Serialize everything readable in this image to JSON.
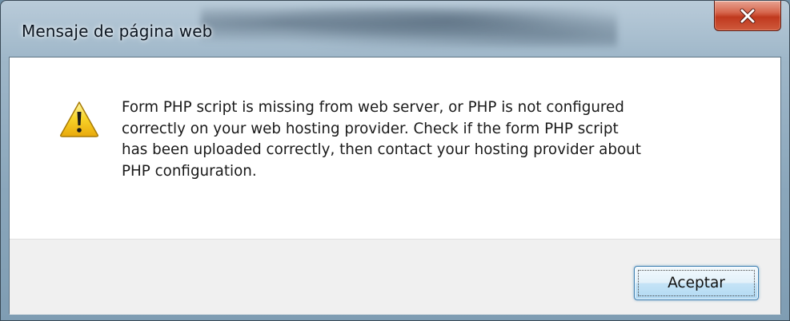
{
  "dialog": {
    "title": "Mensaje de página web",
    "message": "Form PHP script is missing from web server, or PHP is not configured\ncorrectly on your web hosting provider. Check if the form PHP script\nhas been uploaded correctly, then contact your hosting provider about\nPHP configuration.",
    "ok_label": "Aceptar",
    "icon": "warning-icon",
    "close_icon": "close-icon"
  },
  "colors": {
    "close_button": "#c0391e",
    "warning_fill": "#f5c518",
    "button_area": "#f0f0f0",
    "ok_border": "#3c7fb1"
  }
}
